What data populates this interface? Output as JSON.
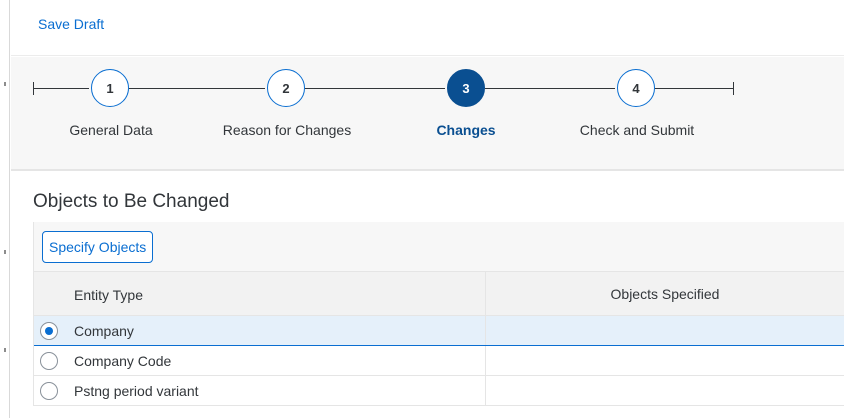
{
  "header": {
    "save_draft_label": "Save Draft"
  },
  "wizard": {
    "steps": [
      {
        "number": "1",
        "label": "General Data",
        "active": false
      },
      {
        "number": "2",
        "label": "Reason for Changes",
        "active": false
      },
      {
        "number": "3",
        "label": "Changes",
        "active": true
      },
      {
        "number": "4",
        "label": "Check and Submit",
        "active": false
      }
    ]
  },
  "section": {
    "title": "Objects to Be Changed"
  },
  "toolbar": {
    "specify_objects_label": "Specify Objects"
  },
  "table": {
    "columns": [
      "Entity Type",
      "Objects Specified"
    ],
    "rows": [
      {
        "entity_type": "Company",
        "objects_specified": "",
        "selected": true
      },
      {
        "entity_type": "Company Code",
        "objects_specified": "",
        "selected": false
      },
      {
        "entity_type": "Pstng period variant",
        "objects_specified": "",
        "selected": false
      }
    ]
  },
  "colors": {
    "accent": "#0a6ed1",
    "active_step": "#0a4f91",
    "selected_row": "#e5f0fa"
  }
}
